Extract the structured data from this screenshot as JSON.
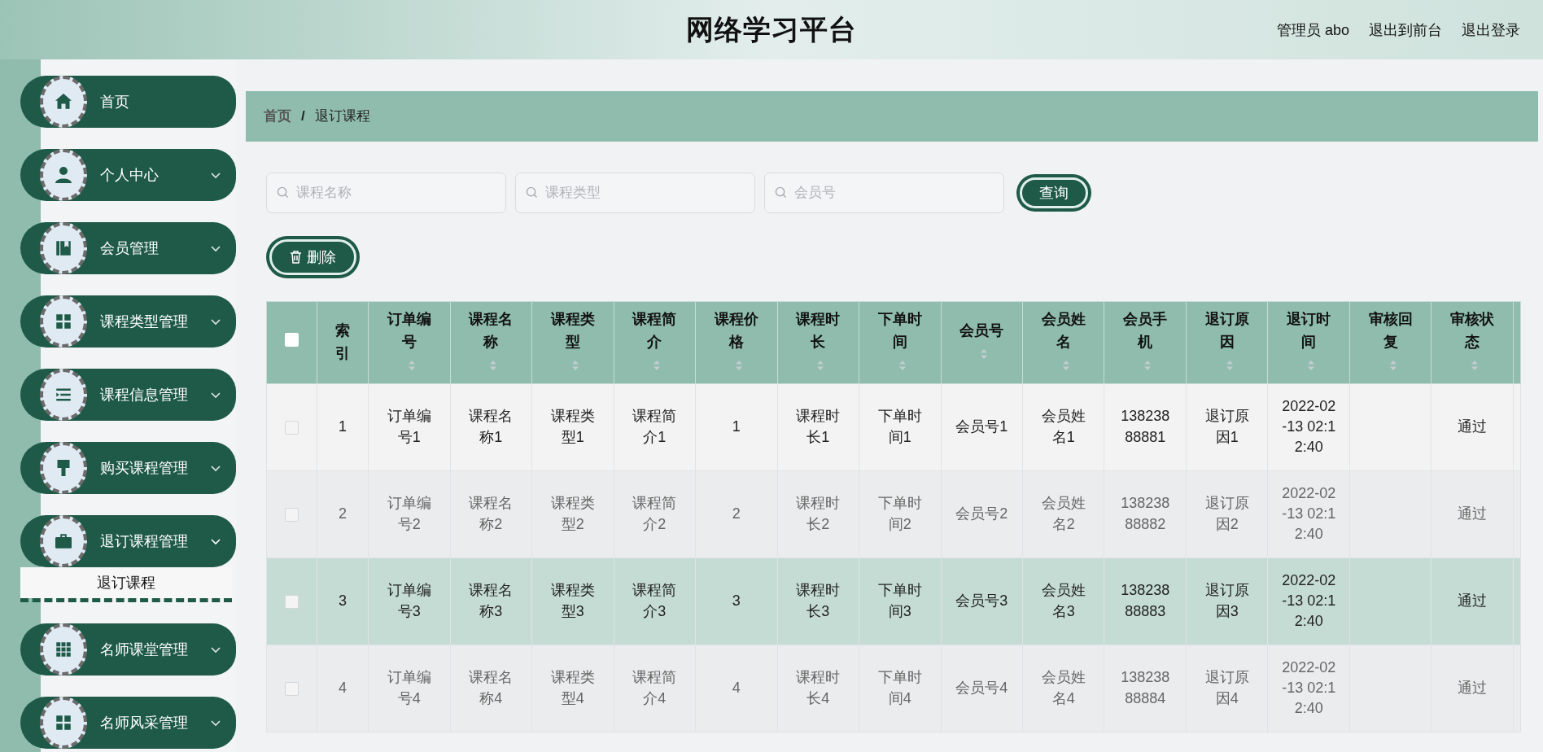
{
  "header": {
    "title": "网络学习平台",
    "links": [
      "管理员 abo",
      "退出到前台",
      "退出登录"
    ]
  },
  "sidebar": {
    "items": [
      {
        "label": "首页",
        "kind": "link"
      },
      {
        "label": "个人中心",
        "kind": "menu",
        "expanded": false
      },
      {
        "label": "会员管理",
        "kind": "menu",
        "expanded": false
      },
      {
        "label": "课程类型管理",
        "kind": "menu",
        "expanded": false
      },
      {
        "label": "课程信息管理",
        "kind": "menu",
        "expanded": false
      },
      {
        "label": "购买课程管理",
        "kind": "menu",
        "expanded": false
      },
      {
        "label": "退订课程管理",
        "kind": "menu",
        "expanded": true,
        "children": [
          {
            "label": "退订课程",
            "selected": true
          }
        ]
      },
      {
        "label": "名师课堂管理",
        "kind": "menu",
        "expanded": false
      },
      {
        "label": "名师风采管理",
        "kind": "menu",
        "expanded": false
      }
    ]
  },
  "breadcrumb": {
    "items": [
      "首页",
      "退订课程"
    ],
    "separator": "/"
  },
  "search": {
    "fields": [
      {
        "placeholder": "课程名称"
      },
      {
        "placeholder": "课程类型"
      },
      {
        "placeholder": "会员号"
      }
    ],
    "button": "查询"
  },
  "actions": [
    {
      "label": "删除"
    }
  ],
  "table": {
    "all_checked": false,
    "columns": [
      "索引",
      "订单编号",
      "课程名称",
      "课程类型",
      "课程简介",
      "课程价格",
      "课程时长",
      "下单时间",
      "会员号",
      "会员姓名",
      "会员手机",
      "退订原因",
      "退订时间",
      "审核回复",
      "审核状态"
    ],
    "rows": [
      {
        "checked": false,
        "highlighted": false,
        "cells": [
          "1",
          "订单编号1",
          "课程名称1",
          "课程类型1",
          "课程简介1",
          "1",
          "课程时长1",
          "下单时间1",
          "会员号1",
          "会员姓名1",
          "13823888881",
          "退订原因1",
          "2022-02-13 02:12:40",
          null,
          "通过"
        ]
      },
      {
        "checked": false,
        "highlighted": false,
        "cells": [
          "2",
          "订单编号2",
          "课程名称2",
          "课程类型2",
          "课程简介2",
          "2",
          "课程时长2",
          "下单时间2",
          "会员号2",
          "会员姓名2",
          "13823888882",
          "退订原因2",
          "2022-02-13 02:12:40",
          null,
          "通过"
        ]
      },
      {
        "checked": false,
        "highlighted": true,
        "cells": [
          "3",
          "订单编号3",
          "课程名称3",
          "课程类型3",
          "课程简介3",
          "3",
          "课程时长3",
          "下单时间3",
          "会员号3",
          "会员姓名3",
          "13823888883",
          "退订原因3",
          "2022-02-13 02:12:40",
          null,
          "通过"
        ]
      },
      {
        "checked": false,
        "highlighted": false,
        "cells": [
          "4",
          "订单编号4",
          "课程名称4",
          "课程类型4",
          "课程简介4",
          "4",
          "课程时长4",
          "下单时间4",
          "会员号4",
          "会员姓名4",
          "13823888884",
          "退订原因4",
          "2022-02-13 02:12:40",
          null,
          "通过"
        ]
      }
    ]
  }
}
